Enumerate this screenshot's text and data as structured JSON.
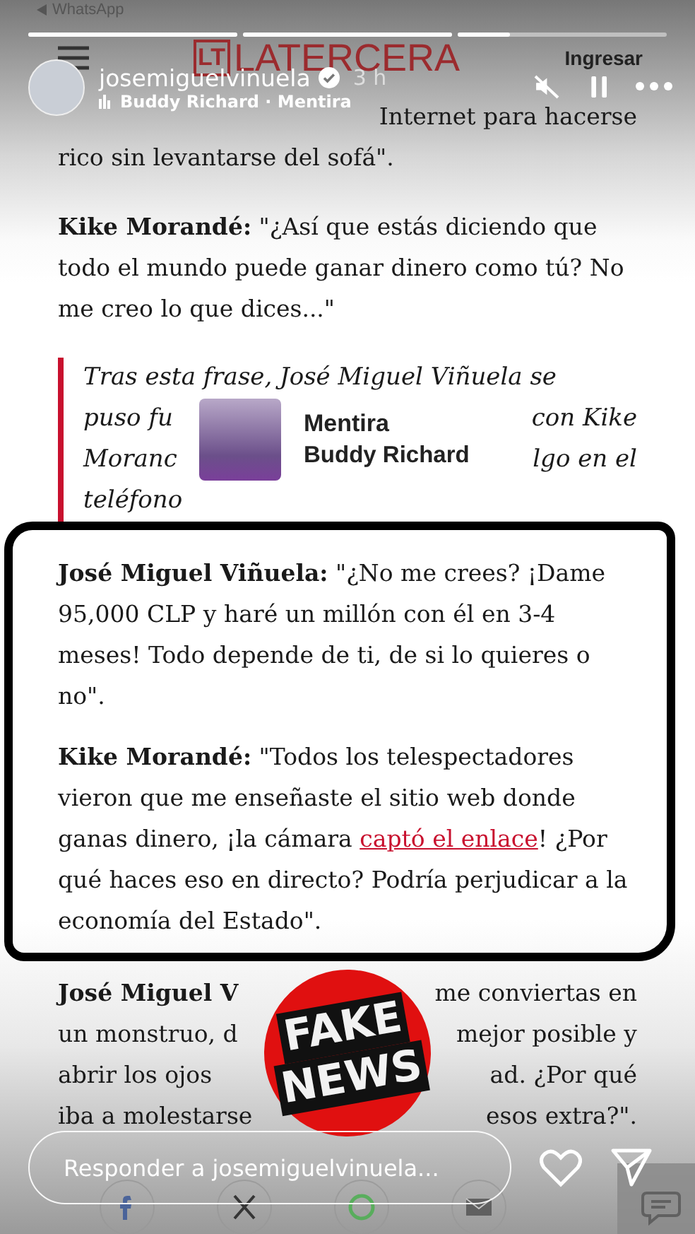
{
  "status_bar": {
    "back_app": "WhatsApp"
  },
  "story": {
    "segments": [
      {
        "level": 1
      },
      {
        "level": 1
      },
      {
        "level": 0.25
      }
    ],
    "username": "josemiguelvinuela",
    "verified": true,
    "time": "3 h",
    "music": "Buddy Richard · Mentira",
    "muted": true,
    "paused": true
  },
  "article_header": {
    "logo_mark": "LT",
    "logo": "LATERCERA",
    "login": "Ingresar"
  },
  "intro_lines": [
    {
      "right": "Internet para hacerse"
    },
    {
      "left": "rico sin levantarse del sofá\"."
    }
  ],
  "paragraph_1": "**Kike Morandé:** \"¿Así que estás diciendo que todo el mundo puede ganar dinero como tú? No me creo lo que dices...\"",
  "quote_lines": [
    {
      "left": "Tras esta frase, José Miguel Viñuela se"
    },
    {
      "left": "puso fu",
      "right": "con Kike"
    },
    {
      "left": "Moranc",
      "right": "lgo en el"
    },
    {
      "left": "teléfono"
    }
  ],
  "music_sticker": {
    "title": "Mentira",
    "artist": "Buddy Richard"
  },
  "highlighted": [
    {
      "text": "**José Miguel Viñuela:** \"¿No me crees? ¡Dame 95,000 CLP y haré un millón con él en 3-4 meses! Todo depende de ti, de si lo quieres o no\"."
    },
    {
      "text": "**Kike Morandé:** \"Todos los telespectadores vieron que me enseñaste el sitio web donde ganas dinero, ¡la cámara ",
      "link": "captó el enlace",
      "after": "! ¿Por qué haces eso en directo? Podría perjudicar a la economía del Estado\"."
    }
  ],
  "closing_lines": [
    {
      "left": "**José Miguel V**",
      "right": "me conviertas en"
    },
    {
      "left": "un monstruo, d",
      "right": "mejor posible y"
    },
    {
      "left": "abrir los ojos",
      "right": "ad. ¿Por qué"
    },
    {
      "left": "iba a molestarse",
      "right": "esos extra?\"."
    }
  ],
  "sticker": {
    "line_1": "FAKE",
    "line_2": "NEWS"
  },
  "reply": {
    "placeholder": "Responder a josemiguelvinuela..."
  }
}
